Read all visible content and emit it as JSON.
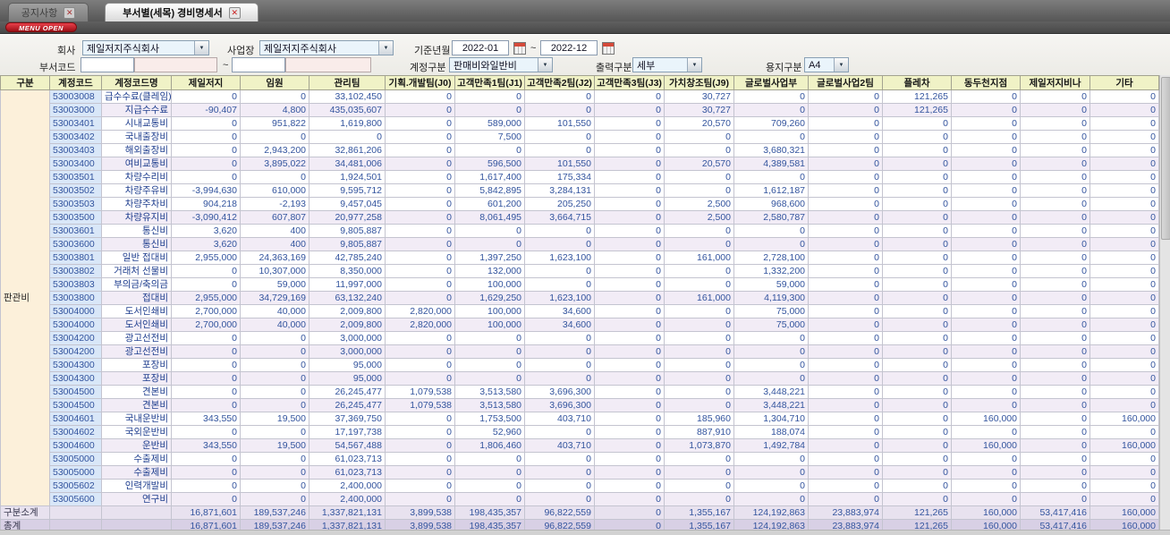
{
  "window": {
    "tabs": [
      {
        "label": "공지사항",
        "active": false
      },
      {
        "label": "부서별(세목) 경비명세서",
        "active": true
      }
    ],
    "menu_button_label": "MENU OPEN"
  },
  "filters": {
    "company": {
      "label": "회사",
      "value": "제일저지주식회사"
    },
    "workplace": {
      "label": "사업장",
      "value": "제일저지주식회사"
    },
    "period": {
      "label": "기준년월",
      "from": "2022-01",
      "to": "2022-12",
      "separator": "~"
    },
    "dept_code": {
      "label": "부서코드",
      "from": "",
      "to": "",
      "separator": "~"
    },
    "account_type": {
      "label": "계정구분",
      "value": "판매비와일반비"
    },
    "output_type": {
      "label": "출력구분",
      "value": "세부"
    },
    "paper_type": {
      "label": "용지구분",
      "value": "A4"
    }
  },
  "table": {
    "group_label": "판관비",
    "columns": [
      "구분",
      "계정코드",
      "계정코드명",
      "제일저지",
      "임원",
      "관리팀",
      "기획.개발팀(J0)",
      "고객만족1팀(J1)",
      "고객만족2팀(J2)",
      "고객만족3팀(J3)",
      "가치창조팀(J9)",
      "글로벌사업부",
      "글로벌사업2팀",
      "플레차",
      "동두천지점",
      "제일저지비나",
      "기타"
    ],
    "rows": [
      {
        "code": "53003008",
        "name": "급수수료(클레임)",
        "summary": false,
        "values": [
          "0",
          "0",
          "33,102,450",
          "0",
          "0",
          "0",
          "0",
          "30,727",
          "0",
          "0",
          "121,265",
          "0",
          "0",
          "0"
        ]
      },
      {
        "code": "53003000",
        "name": "지급수수료",
        "summary": true,
        "values": [
          "-90,407",
          "4,800",
          "435,035,607",
          "0",
          "0",
          "0",
          "0",
          "30,727",
          "0",
          "0",
          "121,265",
          "0",
          "0",
          "0"
        ]
      },
      {
        "code": "53003401",
        "name": "시내교통비",
        "summary": false,
        "values": [
          "0",
          "951,822",
          "1,619,800",
          "0",
          "589,000",
          "101,550",
          "0",
          "20,570",
          "709,260",
          "0",
          "0",
          "0",
          "0",
          "0"
        ]
      },
      {
        "code": "53003402",
        "name": "국내출장비",
        "summary": false,
        "values": [
          "0",
          "0",
          "0",
          "0",
          "7,500",
          "0",
          "0",
          "0",
          "0",
          "0",
          "0",
          "0",
          "0",
          "0"
        ]
      },
      {
        "code": "53003403",
        "name": "해외출장비",
        "summary": false,
        "values": [
          "0",
          "2,943,200",
          "32,861,206",
          "0",
          "0",
          "0",
          "0",
          "0",
          "3,680,321",
          "0",
          "0",
          "0",
          "0",
          "0"
        ]
      },
      {
        "code": "53003400",
        "name": "여비교통비",
        "summary": true,
        "values": [
          "0",
          "3,895,022",
          "34,481,006",
          "0",
          "596,500",
          "101,550",
          "0",
          "20,570",
          "4,389,581",
          "0",
          "0",
          "0",
          "0",
          "0"
        ]
      },
      {
        "code": "53003501",
        "name": "차량수리비",
        "summary": false,
        "values": [
          "0",
          "0",
          "1,924,501",
          "0",
          "1,617,400",
          "175,334",
          "0",
          "0",
          "0",
          "0",
          "0",
          "0",
          "0",
          "0"
        ]
      },
      {
        "code": "53003502",
        "name": "차량주유비",
        "summary": false,
        "values": [
          "-3,994,630",
          "610,000",
          "9,595,712",
          "0",
          "5,842,895",
          "3,284,131",
          "0",
          "0",
          "1,612,187",
          "0",
          "0",
          "0",
          "0",
          "0"
        ]
      },
      {
        "code": "53003503",
        "name": "차량주차비",
        "summary": false,
        "values": [
          "904,218",
          "-2,193",
          "9,457,045",
          "0",
          "601,200",
          "205,250",
          "0",
          "2,500",
          "968,600",
          "0",
          "0",
          "0",
          "0",
          "0"
        ]
      },
      {
        "code": "53003500",
        "name": "차량유지비",
        "summary": true,
        "values": [
          "-3,090,412",
          "607,807",
          "20,977,258",
          "0",
          "8,061,495",
          "3,664,715",
          "0",
          "2,500",
          "2,580,787",
          "0",
          "0",
          "0",
          "0",
          "0"
        ]
      },
      {
        "code": "53003601",
        "name": "통신비",
        "summary": false,
        "values": [
          "3,620",
          "400",
          "9,805,887",
          "0",
          "0",
          "0",
          "0",
          "0",
          "0",
          "0",
          "0",
          "0",
          "0",
          "0"
        ]
      },
      {
        "code": "53003600",
        "name": "통신비",
        "summary": true,
        "values": [
          "3,620",
          "400",
          "9,805,887",
          "0",
          "0",
          "0",
          "0",
          "0",
          "0",
          "0",
          "0",
          "0",
          "0",
          "0"
        ]
      },
      {
        "code": "53003801",
        "name": "일반 접대비",
        "summary": false,
        "values": [
          "2,955,000",
          "24,363,169",
          "42,785,240",
          "0",
          "1,397,250",
          "1,623,100",
          "0",
          "161,000",
          "2,728,100",
          "0",
          "0",
          "0",
          "0",
          "0"
        ]
      },
      {
        "code": "53003802",
        "name": "거래처 선물비",
        "summary": false,
        "values": [
          "0",
          "10,307,000",
          "8,350,000",
          "0",
          "132,000",
          "0",
          "0",
          "0",
          "1,332,200",
          "0",
          "0",
          "0",
          "0",
          "0"
        ]
      },
      {
        "code": "53003803",
        "name": "부의금/축의금",
        "summary": false,
        "values": [
          "0",
          "59,000",
          "11,997,000",
          "0",
          "100,000",
          "0",
          "0",
          "0",
          "59,000",
          "0",
          "0",
          "0",
          "0",
          "0"
        ]
      },
      {
        "code": "53003800",
        "name": "접대비",
        "summary": true,
        "values": [
          "2,955,000",
          "34,729,169",
          "63,132,240",
          "0",
          "1,629,250",
          "1,623,100",
          "0",
          "161,000",
          "4,119,300",
          "0",
          "0",
          "0",
          "0",
          "0"
        ]
      },
      {
        "code": "53004000",
        "name": "도서인쇄비",
        "summary": false,
        "values": [
          "2,700,000",
          "40,000",
          "2,009,800",
          "2,820,000",
          "100,000",
          "34,600",
          "0",
          "0",
          "75,000",
          "0",
          "0",
          "0",
          "0",
          "0"
        ]
      },
      {
        "code": "53004000",
        "name": "도서인쇄비",
        "summary": true,
        "values": [
          "2,700,000",
          "40,000",
          "2,009,800",
          "2,820,000",
          "100,000",
          "34,600",
          "0",
          "0",
          "75,000",
          "0",
          "0",
          "0",
          "0",
          "0"
        ]
      },
      {
        "code": "53004200",
        "name": "광고선전비",
        "summary": false,
        "values": [
          "0",
          "0",
          "3,000,000",
          "0",
          "0",
          "0",
          "0",
          "0",
          "0",
          "0",
          "0",
          "0",
          "0",
          "0"
        ]
      },
      {
        "code": "53004200",
        "name": "광고선전비",
        "summary": true,
        "values": [
          "0",
          "0",
          "3,000,000",
          "0",
          "0",
          "0",
          "0",
          "0",
          "0",
          "0",
          "0",
          "0",
          "0",
          "0"
        ]
      },
      {
        "code": "53004300",
        "name": "포장비",
        "summary": false,
        "values": [
          "0",
          "0",
          "95,000",
          "0",
          "0",
          "0",
          "0",
          "0",
          "0",
          "0",
          "0",
          "0",
          "0",
          "0"
        ]
      },
      {
        "code": "53004300",
        "name": "포장비",
        "summary": true,
        "values": [
          "0",
          "0",
          "95,000",
          "0",
          "0",
          "0",
          "0",
          "0",
          "0",
          "0",
          "0",
          "0",
          "0",
          "0"
        ]
      },
      {
        "code": "53004500",
        "name": "견본비",
        "summary": false,
        "values": [
          "0",
          "0",
          "26,245,477",
          "1,079,538",
          "3,513,580",
          "3,696,300",
          "0",
          "0",
          "3,448,221",
          "0",
          "0",
          "0",
          "0",
          "0"
        ]
      },
      {
        "code": "53004500",
        "name": "견본비",
        "summary": true,
        "values": [
          "0",
          "0",
          "26,245,477",
          "1,079,538",
          "3,513,580",
          "3,696,300",
          "0",
          "0",
          "3,448,221",
          "0",
          "0",
          "0",
          "0",
          "0"
        ]
      },
      {
        "code": "53004601",
        "name": "국내운반비",
        "summary": false,
        "values": [
          "343,550",
          "19,500",
          "37,369,750",
          "0",
          "1,753,500",
          "403,710",
          "0",
          "185,960",
          "1,304,710",
          "0",
          "0",
          "160,000",
          "0",
          "160,000"
        ]
      },
      {
        "code": "53004602",
        "name": "국외운반비",
        "summary": false,
        "values": [
          "0",
          "0",
          "17,197,738",
          "0",
          "52,960",
          "0",
          "0",
          "887,910",
          "188,074",
          "0",
          "0",
          "0",
          "0",
          "0"
        ]
      },
      {
        "code": "53004600",
        "name": "운반비",
        "summary": true,
        "values": [
          "343,550",
          "19,500",
          "54,567,488",
          "0",
          "1,806,460",
          "403,710",
          "0",
          "1,073,870",
          "1,492,784",
          "0",
          "0",
          "160,000",
          "0",
          "160,000"
        ]
      },
      {
        "code": "53005000",
        "name": "수출제비",
        "summary": false,
        "values": [
          "0",
          "0",
          "61,023,713",
          "0",
          "0",
          "0",
          "0",
          "0",
          "0",
          "0",
          "0",
          "0",
          "0",
          "0"
        ]
      },
      {
        "code": "53005000",
        "name": "수출제비",
        "summary": true,
        "values": [
          "0",
          "0",
          "61,023,713",
          "0",
          "0",
          "0",
          "0",
          "0",
          "0",
          "0",
          "0",
          "0",
          "0",
          "0"
        ]
      },
      {
        "code": "53005602",
        "name": "인력개발비",
        "summary": false,
        "values": [
          "0",
          "0",
          "2,400,000",
          "0",
          "0",
          "0",
          "0",
          "0",
          "0",
          "0",
          "0",
          "0",
          "0",
          "0"
        ]
      },
      {
        "code": "53005600",
        "name": "연구비",
        "summary": true,
        "values": [
          "0",
          "0",
          "2,400,000",
          "0",
          "0",
          "0",
          "0",
          "0",
          "0",
          "0",
          "0",
          "0",
          "0",
          "0"
        ]
      }
    ],
    "subtotal": {
      "label": "구분소계",
      "values": [
        "16,871,601",
        "189,537,246",
        "1,337,821,131",
        "3,899,538",
        "198,435,357",
        "96,822,559",
        "0",
        "1,355,167",
        "124,192,863",
        "23,883,974",
        "121,265",
        "160,000",
        "53,417,416",
        "160,000"
      ]
    },
    "total": {
      "label": "총계",
      "values": [
        "16,871,601",
        "189,537,246",
        "1,337,821,131",
        "3,899,538",
        "198,435,357",
        "96,822,559",
        "0",
        "1,355,167",
        "124,192,863",
        "23,883,974",
        "121,265",
        "160,000",
        "53,417,416",
        "160,000"
      ]
    }
  },
  "colors": {
    "accent_red": "#c0131c",
    "header_bg": "#f0f2c6",
    "summary_row_bg": "#f2ecf6",
    "code_cell_bg": "#d9e7f8",
    "group_cell_bg": "#fcf0da",
    "subtotal_row_bg": "#e8e2ef",
    "total_row_bg": "#d8d0e5",
    "number_text": "#33549e"
  }
}
